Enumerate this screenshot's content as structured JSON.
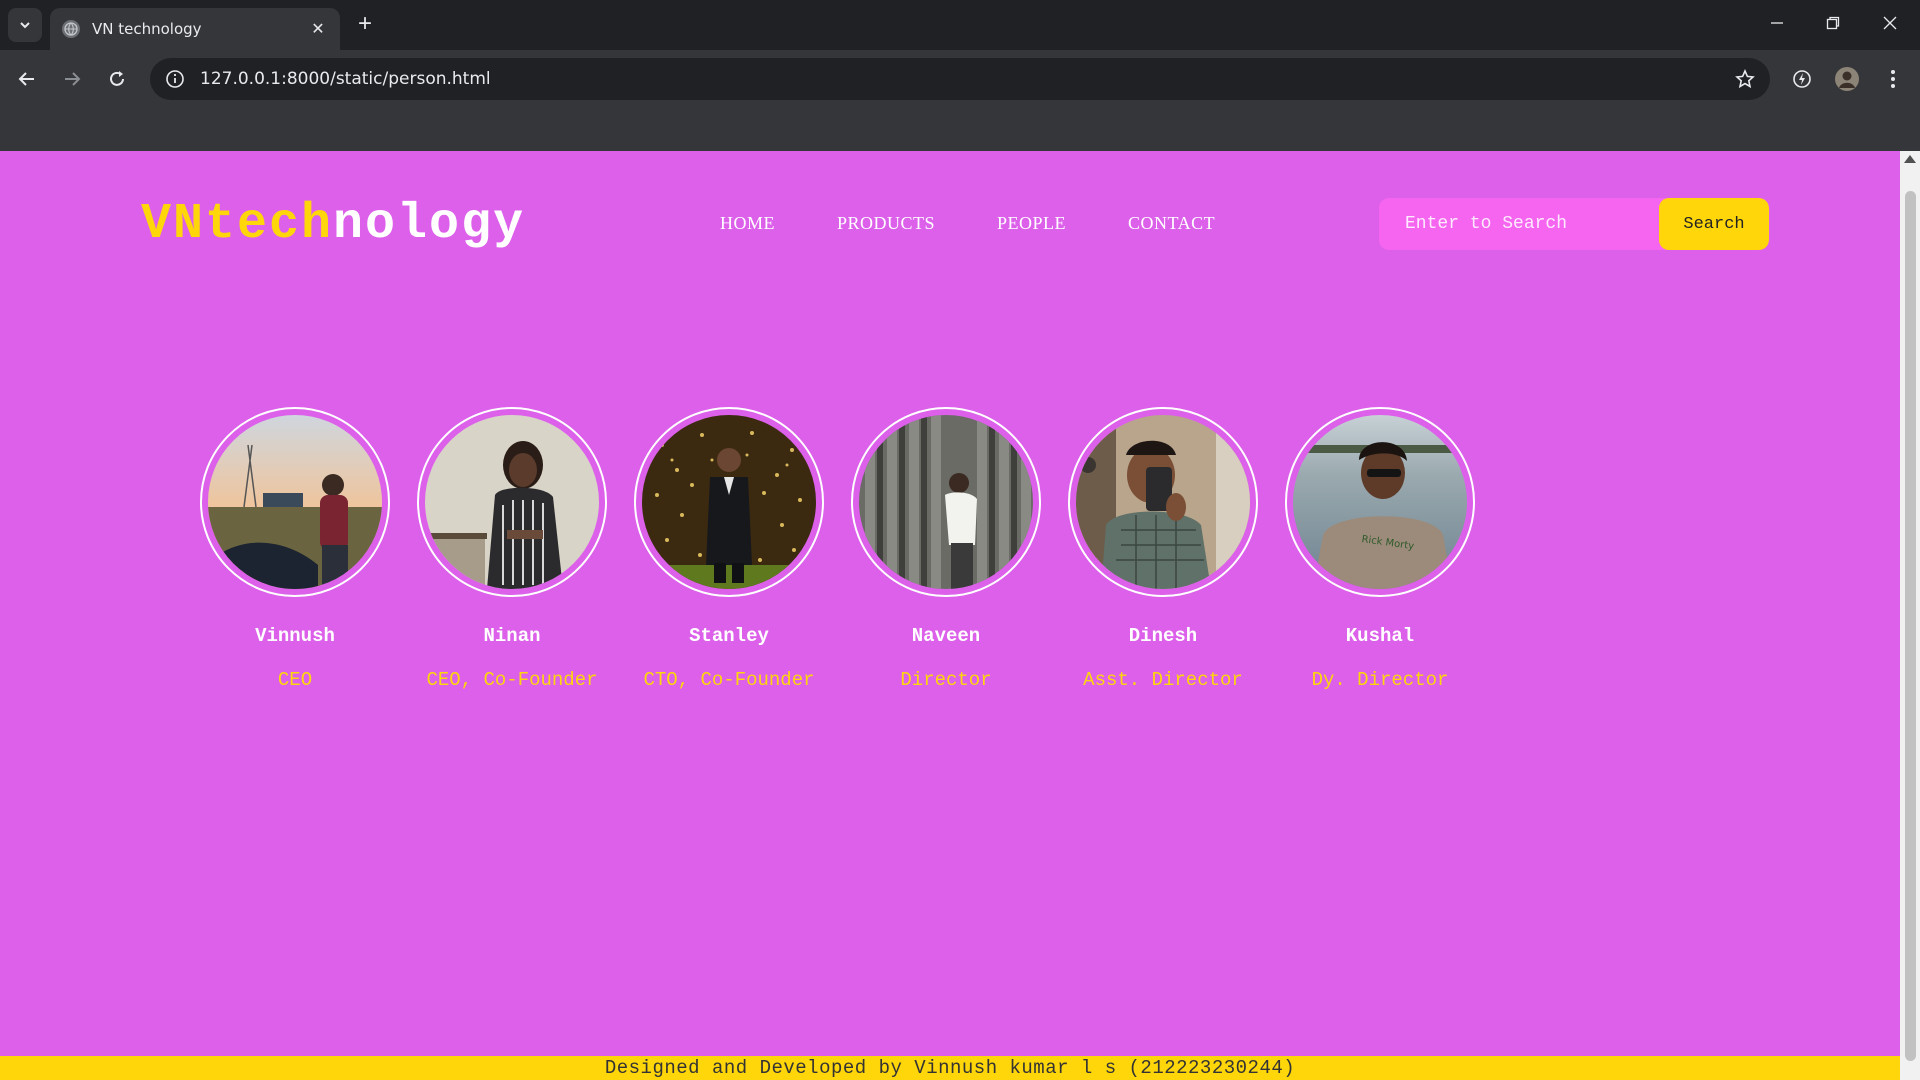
{
  "browser": {
    "tab_title": "VN technology",
    "url": "127.0.0.1:8000/static/person.html",
    "icons": [
      "tab-search-icon",
      "globe-icon",
      "close-icon",
      "plus-icon",
      "minimize-icon",
      "restore-icon",
      "window-close-icon",
      "back-icon",
      "forward-icon",
      "reload-icon",
      "info-icon",
      "star-icon",
      "extension-icon",
      "profile-avatar",
      "menu-icon"
    ]
  },
  "header": {
    "logo": {
      "part1": "VN",
      "part2": "tech",
      "part3": "nology"
    },
    "nav": [
      "HOME",
      "PRODUCTS",
      "PEOPLE",
      "CONTACT"
    ],
    "search": {
      "placeholder": "Enter to Search",
      "button": "Search"
    }
  },
  "people": [
    {
      "name": "Vinnush",
      "role": "CEO"
    },
    {
      "name": "Ninan",
      "role": "CEO, Co-Founder"
    },
    {
      "name": "Stanley",
      "role": "CTO, Co-Founder"
    },
    {
      "name": "Naveen",
      "role": "Director"
    },
    {
      "name": "Dinesh",
      "role": "Asst. Director"
    },
    {
      "name": "Kushal",
      "role": "Dy. Director"
    }
  ],
  "footer": {
    "text": "Designed and Developed by Vinnush kumar l s (212223230244)"
  },
  "colors": {
    "page_bg": "#dc60ea",
    "accent": "#ffd60a",
    "search_bg": "#f565f0"
  }
}
